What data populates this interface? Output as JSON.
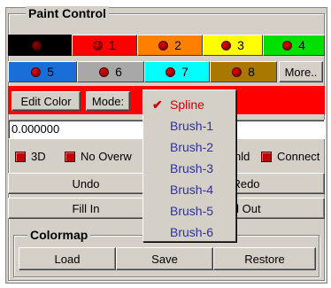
{
  "title": "Paint Control",
  "swatches_row1": [
    {
      "label": "",
      "color": "#000000",
      "text_color": "#000000",
      "selected": true
    },
    {
      "label": "1",
      "color": "#ff0000",
      "text_color": "#000000"
    },
    {
      "label": "2",
      "color": "#ff8000",
      "text_color": "#000000"
    },
    {
      "label": "3",
      "color": "#ffff00",
      "text_color": "#000000"
    },
    {
      "label": "4",
      "color": "#00e000",
      "text_color": "#000000"
    }
  ],
  "swatches_row2": [
    {
      "label": "5",
      "color": "#1a6ed8",
      "text_color": "#000000"
    },
    {
      "label": "6",
      "color": "#a8a8a8",
      "text_color": "#000000"
    },
    {
      "label": "7",
      "color": "#00ffff",
      "text_color": "#000000"
    },
    {
      "label": "8",
      "color": "#a87800",
      "text_color": "#000000"
    }
  ],
  "more_label": "More..",
  "edit_color_label": "Edit Color",
  "mode_label": "Mode:",
  "value_field": "0.000000",
  "checks": {
    "three_d": "3D",
    "no_overwrite": "No Overw",
    "thld": "hld",
    "connect": "Connect"
  },
  "buttons": {
    "undo": "Undo",
    "redo": "Redo",
    "fill_in": "Fill In",
    "fill_out": "ill Out"
  },
  "colormap": {
    "title": "Colormap",
    "load": "Load",
    "save": "Save",
    "restore": "Restore"
  },
  "mode_menu": {
    "selected": "Spline",
    "items": [
      "Spline",
      "Brush-1",
      "Brush-2",
      "Brush-3",
      "Brush-4",
      "Brush-5",
      "Brush-6"
    ]
  },
  "colors": {
    "accent_red": "#ff0000",
    "menu_text": "#3030a0",
    "menu_selected": "#d00000"
  }
}
